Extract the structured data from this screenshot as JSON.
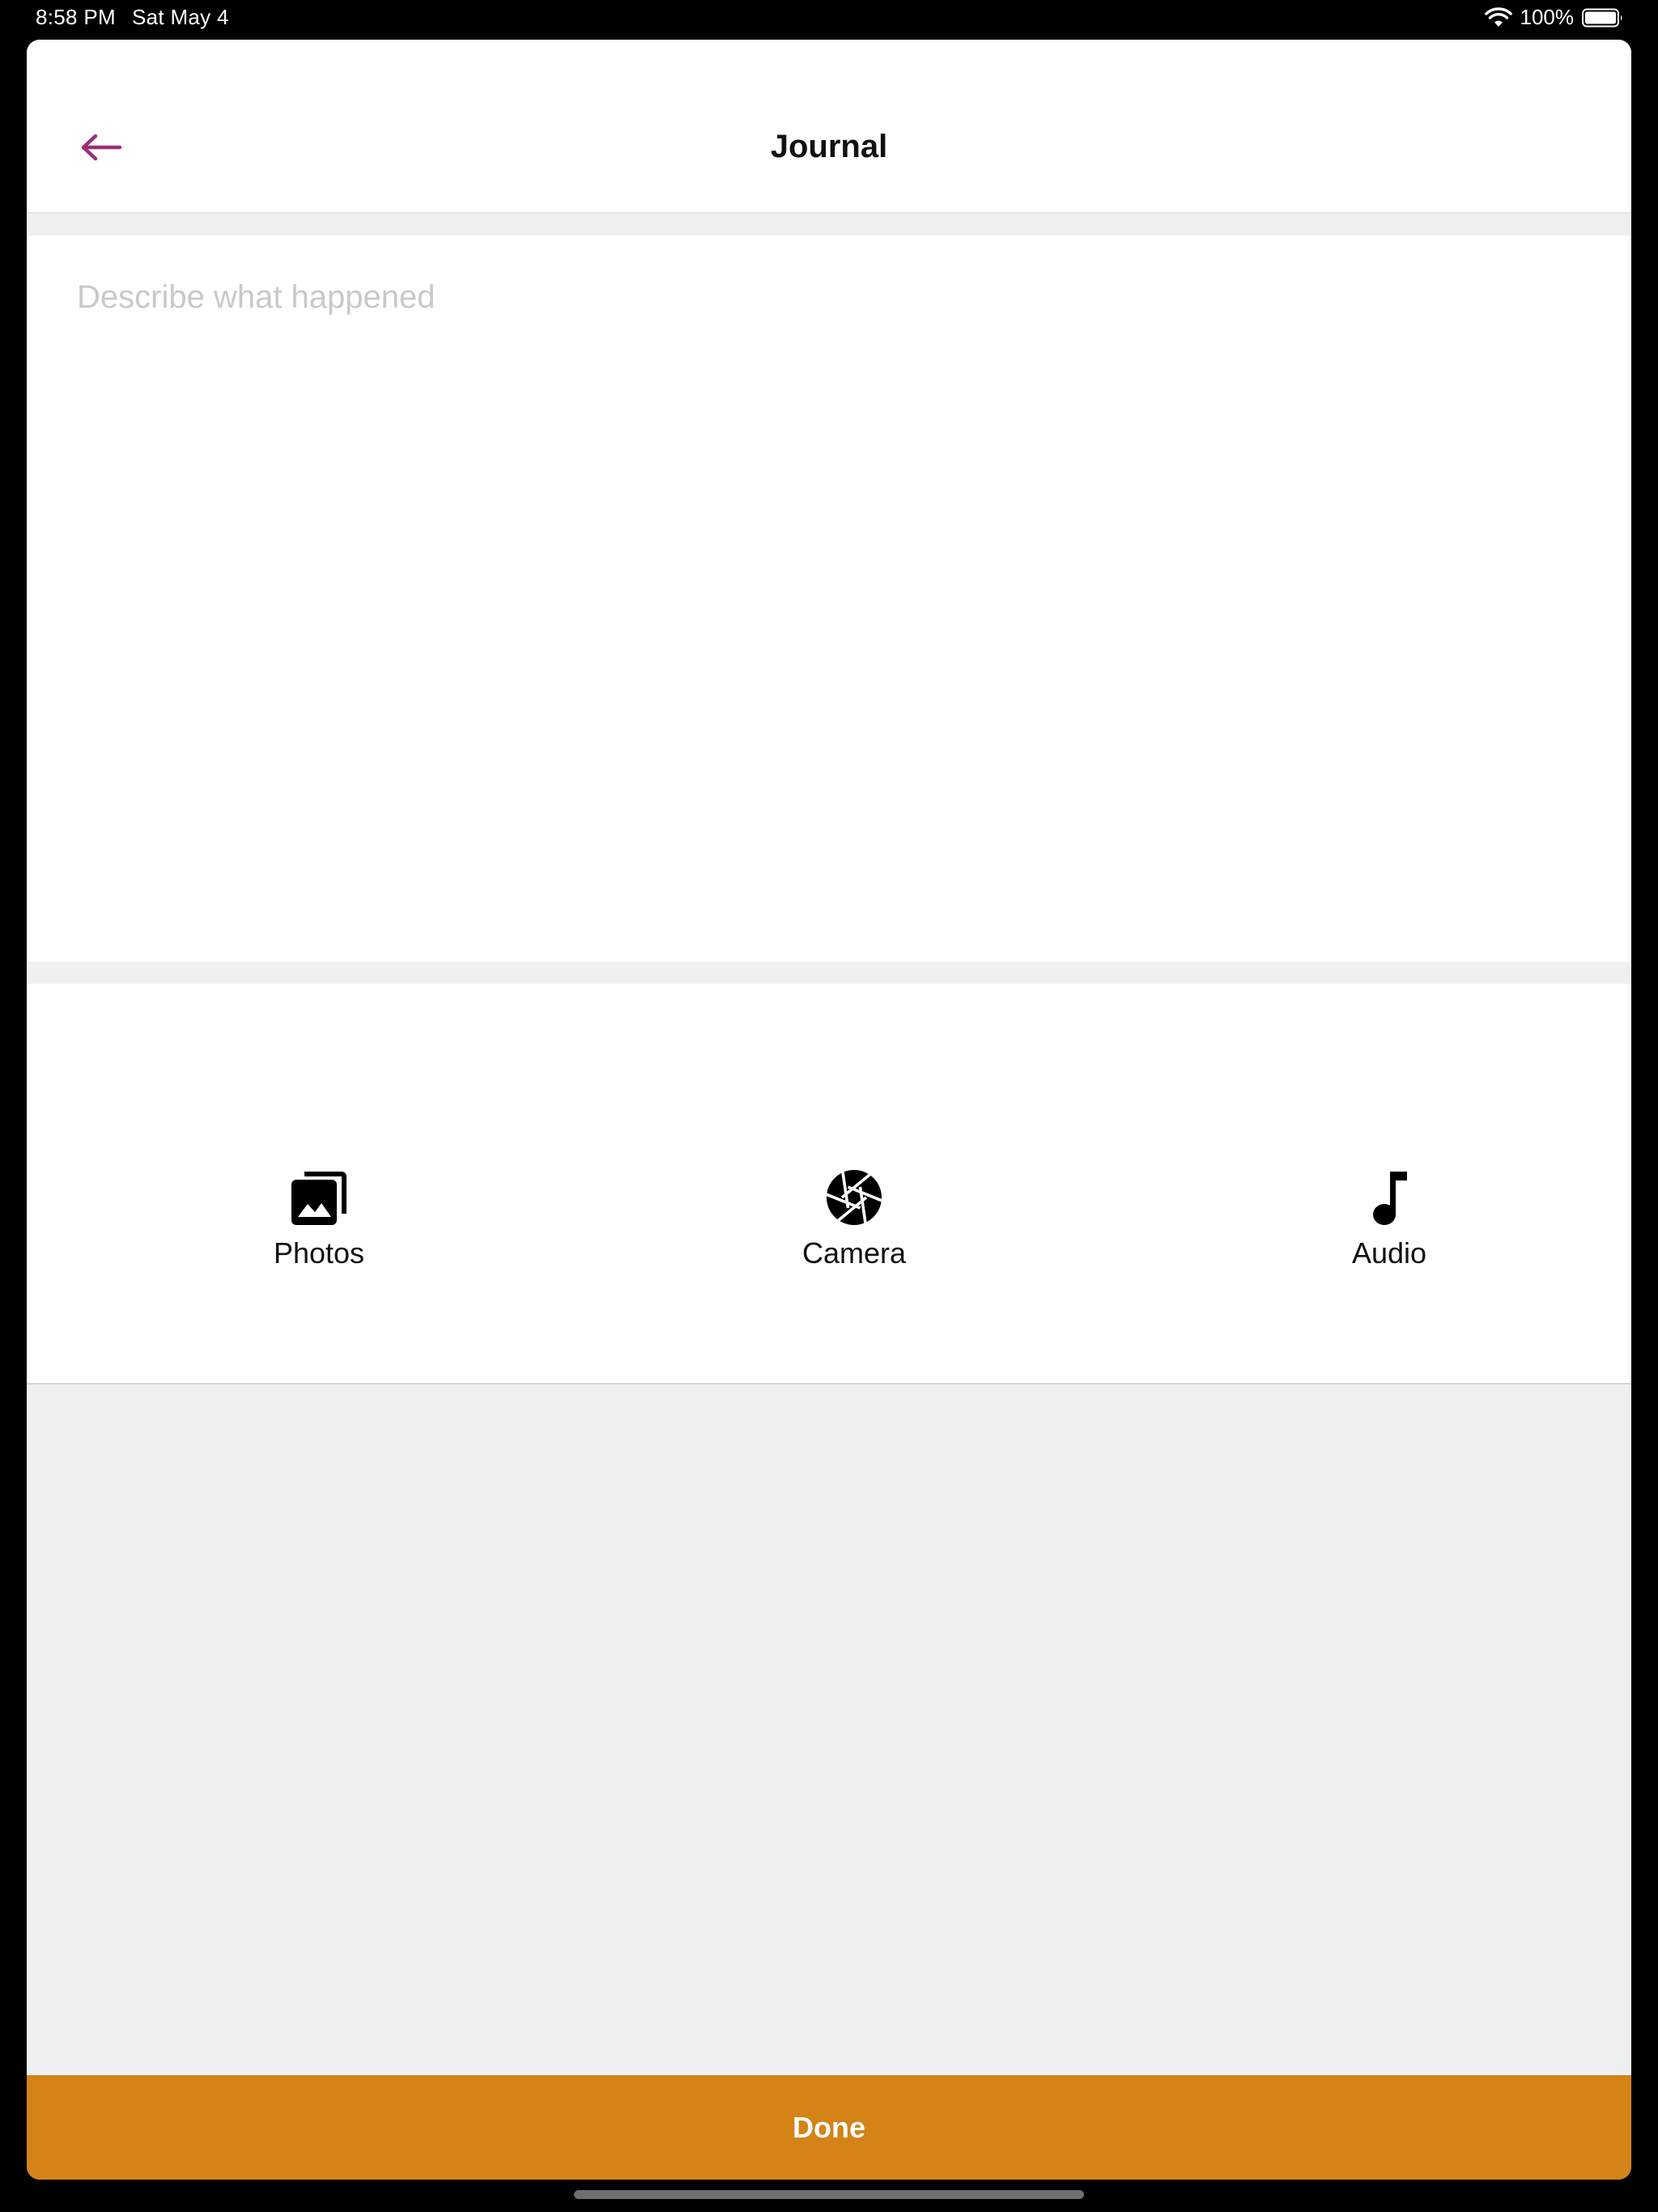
{
  "status_bar": {
    "time": "8:58 PM",
    "date": "Sat May 4",
    "battery": "100%",
    "wifi_icon": "wifi-icon",
    "battery_icon": "battery-icon"
  },
  "header": {
    "title": "Journal",
    "back_icon": "arrow-left-icon"
  },
  "editor": {
    "placeholder": "Describe what happened",
    "value": ""
  },
  "media": {
    "items": [
      {
        "label": "Photos",
        "icon": "photos-icon"
      },
      {
        "label": "Camera",
        "icon": "camera-aperture-icon"
      },
      {
        "label": "Audio",
        "icon": "music-note-icon"
      }
    ]
  },
  "footer": {
    "done_label": "Done"
  },
  "colors": {
    "accent": "#9c2f7c",
    "done_button": "#d48316",
    "placeholder": "#c9c9c9",
    "empty_area": "#eff0f2"
  }
}
